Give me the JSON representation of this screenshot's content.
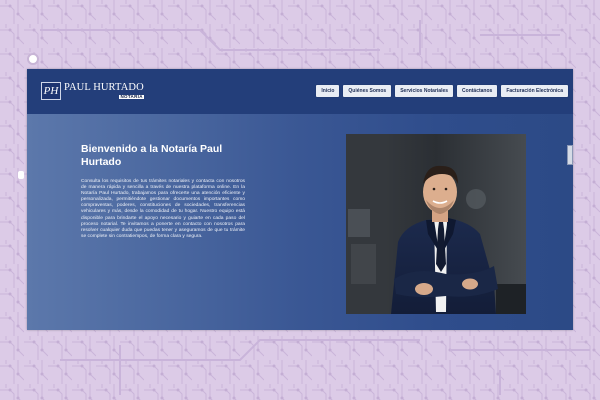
{
  "logo": {
    "monogram": "PH",
    "name": "PAUL HURTADO",
    "subtitle": "NOTARIA"
  },
  "nav": {
    "items": [
      "Inicio",
      "Quiénes Somos",
      "Servicios Notariales",
      "Contáctanos",
      "Facturación Electrónica"
    ]
  },
  "hero": {
    "title": "Bienvenido a la Notaría Paul Hurtado",
    "body": "Consulta los requisitos de tus trámites notariales y contacta con nosotros de manera rápida y sencilla a través de nuestra plataforma online. En la Notaría Paul Hurtado, trabajamos para ofrecerte una atención eficiente y personalizada, permitiéndote gestionar documentos importantes como compraventas, poderes, constituciones de sociedades, transferencias vehiculares y más, desde la comodidad de tu hogar. Nuestro equipo está disponible para brindarte el apoyo necesario y guiarte en cada paso del proceso notarial. Te invitamos a ponerte en contacto con nosotros para resolver cualquier duda que puedas tener y aseguramos de que tu trámite se complete sin contratiempos, de forma clara y segura."
  },
  "colors": {
    "header": "#233e7a",
    "panel": "#2c4a86",
    "nav_button": "#e9edf4",
    "background": "#d8c6e4"
  }
}
